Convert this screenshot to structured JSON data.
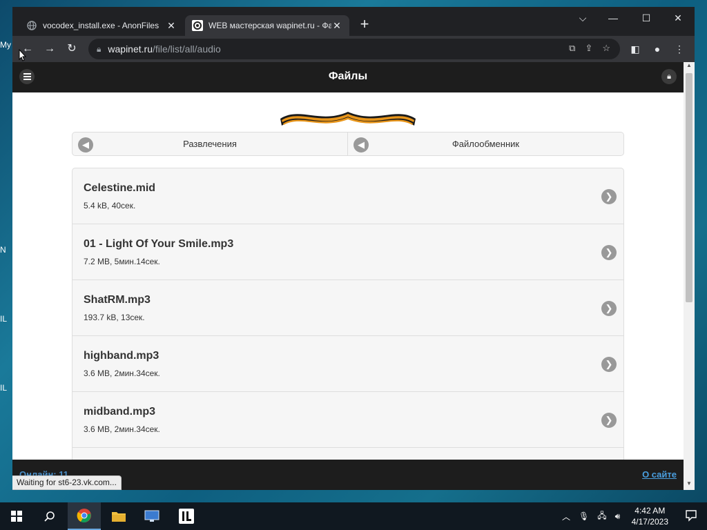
{
  "desktop": {
    "icon_texts": [
      "My",
      "N",
      "IL",
      "IL"
    ]
  },
  "browser": {
    "tabs": [
      {
        "title": "vocodex_install.exe - AnonFiles",
        "active": false
      },
      {
        "title": "WEB мастерская wapinet.ru - Фа",
        "active": true
      }
    ],
    "new_tab": "+",
    "url_host": "wapinet.ru",
    "url_path": "/file/list/all/audio",
    "status_text": "Waiting for st6-23.vk.com..."
  },
  "page": {
    "header_title": "Файлы",
    "nav": [
      {
        "label": "Развлечения"
      },
      {
        "label": "Файлообменник"
      }
    ],
    "files": [
      {
        "name": "Celestine.mid",
        "meta": "5.4 kB, 40сек."
      },
      {
        "name": "01 - Light Of Your Smile.mp3",
        "meta": "7.2 MB, 5мин.14сек."
      },
      {
        "name": "ShatRM.mp3",
        "meta": "193.7 kB, 13сек."
      },
      {
        "name": "highband.mp3",
        "meta": "3.6 MB, 2мин.34сек."
      },
      {
        "name": "midband.mp3",
        "meta": "3.6 MB, 2мин.34сек."
      }
    ],
    "footer_online": "Онлайн: 11",
    "footer_about": "О сайте"
  },
  "taskbar": {
    "time": "4:42 AM",
    "date": "4/17/2023"
  },
  "colors": {
    "site_header": "#1d1d1d",
    "link": "#4a9fe0",
    "chrome_dark": "#202124"
  }
}
